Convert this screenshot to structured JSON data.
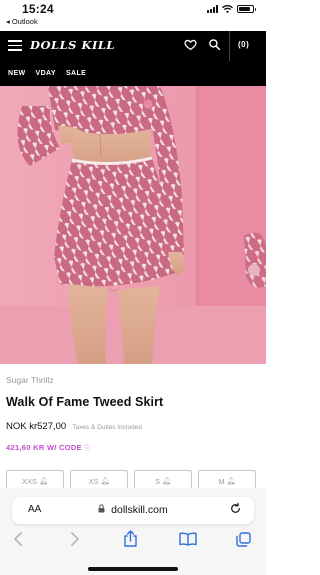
{
  "status_bar": {
    "time": "15:24",
    "back_app": "◂ Outlook",
    "battery_level": 0.85
  },
  "header": {
    "logo": "DOLLS KILL",
    "cart_count": "(0)",
    "icons": [
      "menu-icon",
      "heart-icon",
      "search-icon"
    ]
  },
  "nav": {
    "items": [
      "NEW",
      "VDAY",
      "SALE"
    ]
  },
  "product": {
    "brand": "Sugar Thrillz",
    "title": "Walk Of Fame Tweed Skirt",
    "price": "NOK kr527,00",
    "tax_note": "Taxes & Duties Included",
    "promo": "421,60 KR W/ CODE",
    "promo_icon": "ⓘ",
    "sizes": [
      "XXS",
      "XS",
      "S",
      "M"
    ]
  },
  "browser": {
    "aa_label": "AA",
    "url": "dollskill.com",
    "toolbar_icons": [
      "back-icon",
      "forward-icon",
      "share-icon",
      "bookmarks-icon",
      "tabs-icon"
    ]
  },
  "colors": {
    "accent_promo": "#c24ecf",
    "safari_blue": "#2e6fd9",
    "hero_background": "#eea4b4"
  }
}
